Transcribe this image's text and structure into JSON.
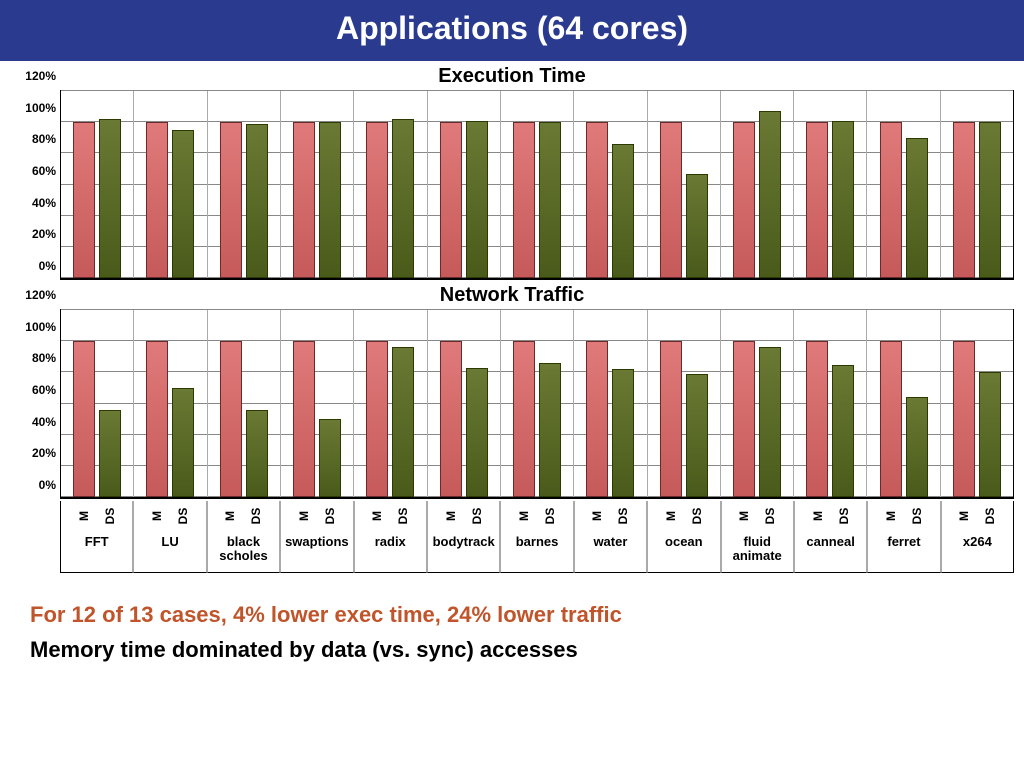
{
  "title": "Applications (64 cores)",
  "series_labels": {
    "m": "M",
    "ds": "DS"
  },
  "yticks": [
    "0%",
    "20%",
    "40%",
    "60%",
    "80%",
    "100%",
    "120%"
  ],
  "ymax": 120,
  "notes": {
    "line1": "For 12 of 13 cases, 4% lower exec time, 24% lower traffic",
    "line2": "Memory time dominated by data (vs. sync) accesses"
  },
  "chart_data": [
    {
      "type": "bar",
      "title": "Execution Time",
      "ylabel": "",
      "ylim": [
        0,
        120
      ],
      "categories": [
        "FFT",
        "LU",
        "black scholes",
        "swaptions",
        "radix",
        "bodytrack",
        "barnes",
        "water",
        "ocean",
        "fluid animate",
        "canneal",
        "ferret",
        "x264"
      ],
      "series": [
        {
          "name": "M",
          "values": [
            100,
            100,
            100,
            100,
            100,
            100,
            100,
            100,
            100,
            100,
            100,
            100,
            100
          ]
        },
        {
          "name": "DS",
          "values": [
            102,
            95,
            99,
            100,
            102,
            101,
            100,
            86,
            67,
            107,
            101,
            90,
            100
          ]
        }
      ]
    },
    {
      "type": "bar",
      "title": "Network Traffic",
      "ylabel": "",
      "ylim": [
        0,
        120
      ],
      "categories": [
        "FFT",
        "LU",
        "black scholes",
        "swaptions",
        "radix",
        "bodytrack",
        "barnes",
        "water",
        "ocean",
        "fluid animate",
        "canneal",
        "ferret",
        "x264"
      ],
      "series": [
        {
          "name": "M",
          "values": [
            100,
            100,
            100,
            100,
            100,
            100,
            100,
            100,
            100,
            100,
            100,
            100,
            100
          ]
        },
        {
          "name": "DS",
          "values": [
            56,
            70,
            56,
            50,
            96,
            83,
            86,
            82,
            79,
            96,
            85,
            64,
            80
          ]
        }
      ]
    }
  ]
}
